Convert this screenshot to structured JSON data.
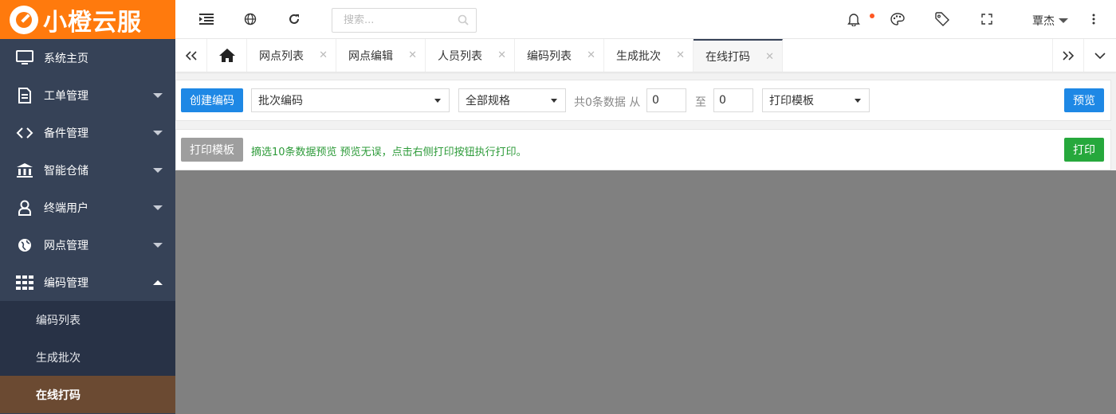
{
  "brand": {
    "name": "小橙云服",
    "color": "#ff7a0d"
  },
  "sidebar": {
    "items": [
      {
        "label": "系统主页",
        "icon": "monitor-icon"
      },
      {
        "label": "工单管理",
        "icon": "document-icon"
      },
      {
        "label": "备件管理",
        "icon": "link-icon"
      },
      {
        "label": "智能仓储",
        "icon": "bank-icon"
      },
      {
        "label": "终端用户",
        "icon": "user-icon"
      },
      {
        "label": "网点管理",
        "icon": "globe-icon"
      },
      {
        "label": "编码管理",
        "icon": "grid-icon"
      }
    ],
    "submenu": [
      {
        "label": "编码列表"
      },
      {
        "label": "生成批次"
      },
      {
        "label": "在线打码",
        "active": true
      }
    ]
  },
  "header": {
    "search_placeholder": "搜索...",
    "user_name": "覃杰"
  },
  "tabs": [
    {
      "label": "网点列表"
    },
    {
      "label": "网点编辑"
    },
    {
      "label": "人员列表"
    },
    {
      "label": "编码列表"
    },
    {
      "label": "生成批次"
    },
    {
      "label": "在线打码",
      "active": true
    }
  ],
  "toolbar": {
    "create_label": "创建编码",
    "batch_select": "批次编码",
    "spec_select": "全部规格",
    "count_text": "共0条数据 从",
    "from_value": "0",
    "to_label": "至",
    "to_value": "0",
    "template_select": "打印模板",
    "preview_label": "预览"
  },
  "printbar": {
    "template_button": "打印模板",
    "tip": "摘选10条数据预览 预览无误，点击右侧打印按钮执行打印。",
    "print_button": "打印"
  },
  "colors": {
    "sidebar_bg": "#364257",
    "primary": "#1e88e5",
    "success": "#26a83c",
    "preview_bg": "#808080"
  }
}
